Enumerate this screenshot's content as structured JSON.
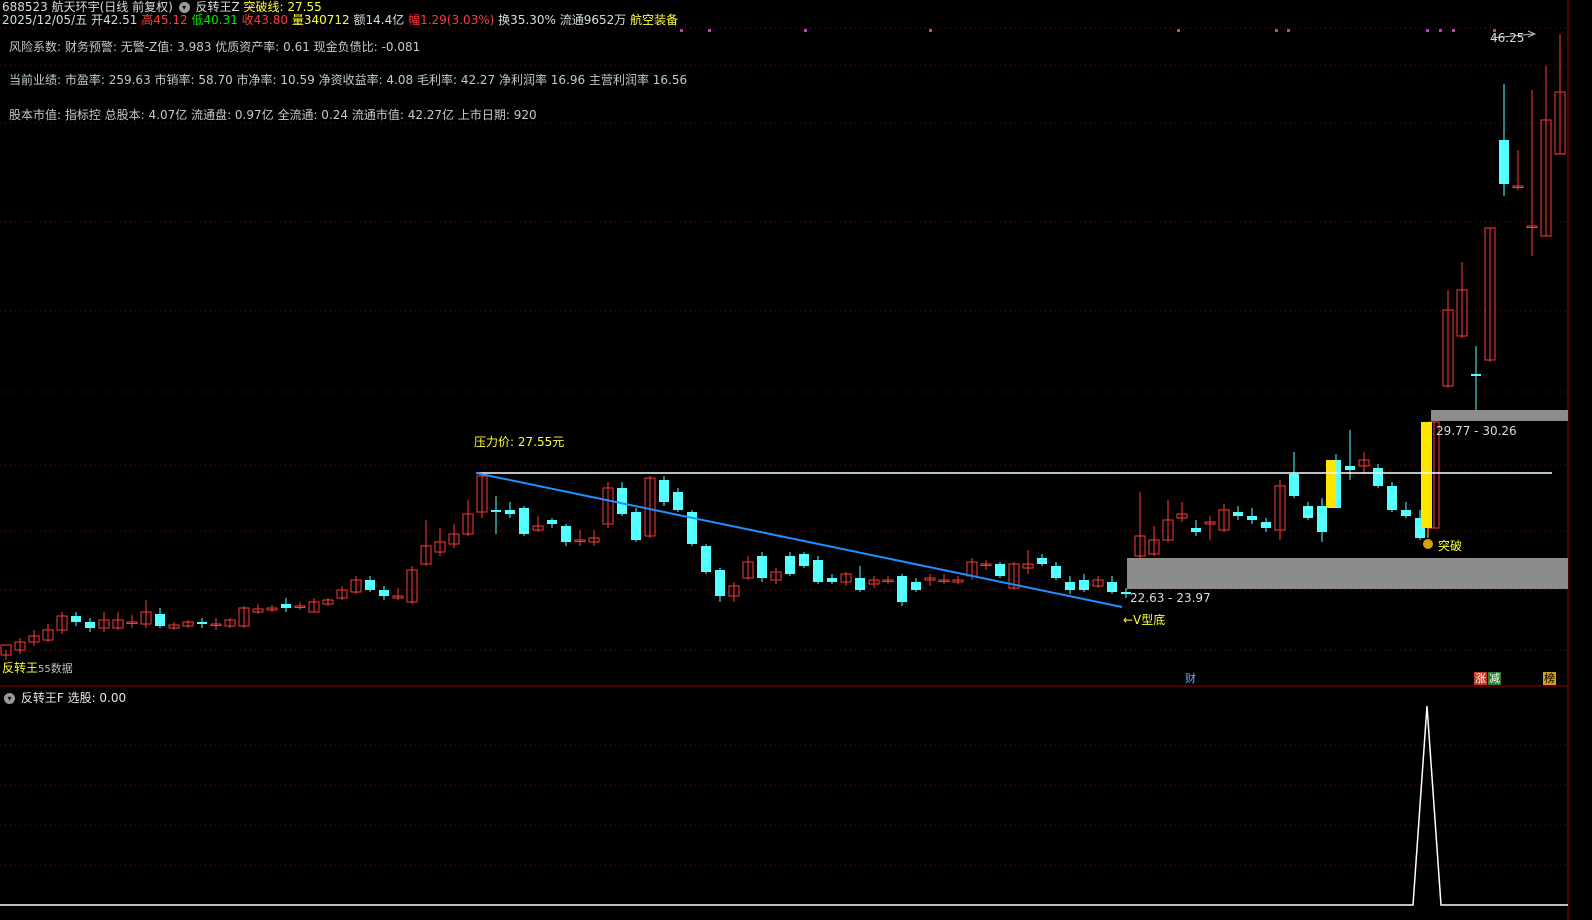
{
  "header": {
    "code_name": "688523 航天环宇(日线 前复权)",
    "indicator_name": "反转王Z",
    "breakout_label": "突破线: 27.55",
    "date": "2025/12/05/五",
    "open_label": "开",
    "open": "42.51",
    "high_label": "高",
    "high": "45.12",
    "low_label": "低",
    "low": "40.31",
    "close_label": "收",
    "close": "43.80",
    "vol_label": "量",
    "volume": "340712",
    "amount": "额14.4亿",
    "change_label": "幅",
    "change": "1.29(3.03%)",
    "turnover": "换35.30%",
    "float": "流通9652万",
    "sector": "航空装备"
  },
  "info_lines": {
    "risk": "风险系数:    财务预警: 无警-Z值: 3.983 优质资产率: 0.61 现金负债比: -0.081",
    "perf": "当前业绩: 市盈率: 259.63 市销率: 58.70 市净率: 10.59 净资收益率: 4.08 毛利率: 42.27 净利润率 16.96 主营利润率 16.56",
    "capital": "股本市值: 指标控   总股本: 4.07亿 流通盘: 0.97亿 全流通: 0.24 流通市值: 42.27亿 上市日期: 920"
  },
  "annotations": {
    "pressure": "压力价:  27.55元",
    "upper_zone": "29.77 - 30.26",
    "lower_zone": "22.63 - 23.97",
    "v_bottom": "←V型底",
    "breakout": "突破",
    "peak_price": "46.25",
    "left_label": "反转王",
    "left_value": "55",
    "left_note": "数据"
  },
  "badges": {
    "cai": "财",
    "zhang": "涨",
    "jian": "减",
    "bang": "榜"
  },
  "subchart": {
    "name": "反转王F",
    "value_label": "选股: 0.00"
  },
  "colors": {
    "up": "#ff3b3b",
    "down": "#54ffff",
    "trend": "#1e90ff",
    "zone": "#8c8c8c",
    "highlight": "#ffe400",
    "grid": "#8b0000"
  }
}
